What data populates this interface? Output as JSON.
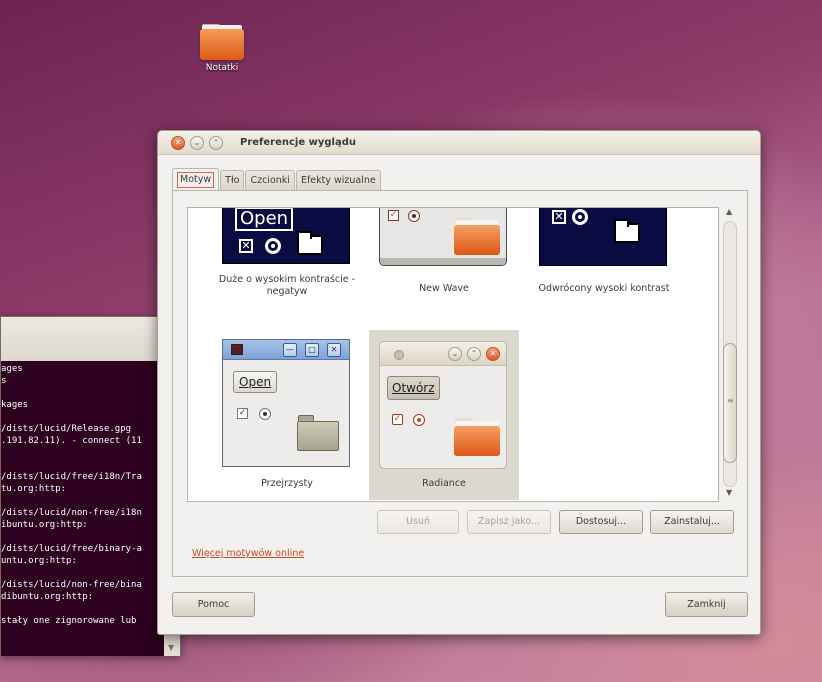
{
  "desktop": {
    "icon_label": "Notatki"
  },
  "terminal": {
    "lines": [
      "ages",
      "s",
      "",
      "kages",
      "",
      "/dists/lucid/Release.gpg",
      ".191.82.11). - connect (11",
      "",
      "",
      "/dists/lucid/free/i18n/Tra",
      "tu.org:http:",
      "",
      "/dists/lucid/non-free/i18n",
      "ibuntu.org:http:",
      "",
      "/dists/lucid/free/binary-a",
      "untu.org:http:",
      "",
      "/dists/lucid/non-free/bina",
      "dibuntu.org:http:",
      "",
      "stały one zignorowane lub"
    ]
  },
  "dialog": {
    "title": "Preferencje wyglądu",
    "tabs": [
      "Motyw",
      "Tło",
      "Czcionki",
      "Efekty wizualne"
    ],
    "themes": [
      {
        "name": "Duże o wysokim kontraście - negatyw",
        "preview_button": "Open",
        "style": "high-contrast-inverse"
      },
      {
        "name": "New Wave",
        "style": "new-wave"
      },
      {
        "name": "Odwrócony wysoki kontrast",
        "style": "high-contrast-inverse"
      },
      {
        "name": "Przejrzysty",
        "preview_button": "Open",
        "style": "clearlooks"
      },
      {
        "name": "Radiance",
        "preview_button": "Otwórz",
        "style": "radiance",
        "selected": true
      }
    ],
    "buttons": {
      "remove": "Usuń",
      "save_as": "Zapisz jako...",
      "customize": "Dostosuj...",
      "install": "Zainstaluj...",
      "help": "Pomoc",
      "close": "Zamknij"
    },
    "more_themes_link": "Więcej motywów online"
  },
  "colors": {
    "accent": "#dd4814",
    "link": "#d3491f",
    "high_contrast_bg": "#0b0b44",
    "terminal_bg": "#2c001e"
  }
}
